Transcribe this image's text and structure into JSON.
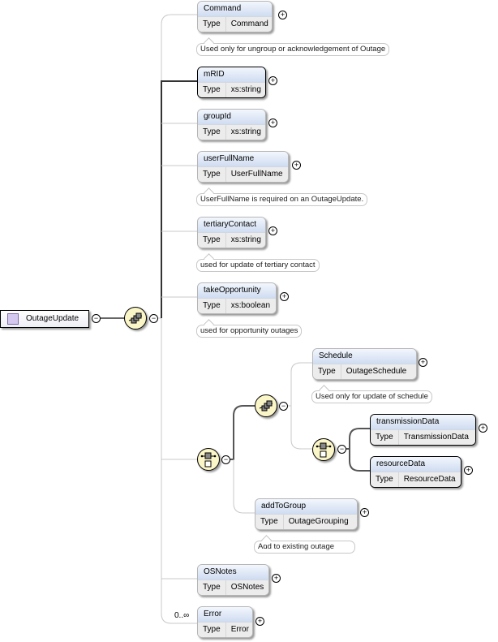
{
  "root": {
    "name": "OutageUpdate",
    "icon": "complex-type-icon"
  },
  "compositors": {
    "main_sequence": {
      "kind": "sequence",
      "icon": "sequence-icon"
    },
    "choice": {
      "kind": "choice",
      "icon": "choice-icon"
    },
    "inner_sequence": {
      "kind": "sequence",
      "icon": "sequence-icon"
    },
    "inner_choice": {
      "kind": "choice",
      "icon": "choice-icon"
    }
  },
  "type_label": "Type",
  "elements": {
    "command": {
      "name": "Command",
      "type": "Command",
      "doc": "Used only for ungroup or acknowledgement of Outage",
      "required": false
    },
    "mrid": {
      "name": "mRID",
      "type": "xs:string",
      "required": true
    },
    "groupid": {
      "name": "groupId",
      "type": "xs:string",
      "required": false
    },
    "userfullname": {
      "name": "userFullName",
      "type": "UserFullName",
      "doc": "UserFullName is required on an OutageUpdate.",
      "required": false
    },
    "tertiarycontact": {
      "name": "tertiaryContact",
      "type": "xs:string",
      "doc": "used for update of tertiary contact",
      "required": false
    },
    "takeopportunity": {
      "name": "takeOpportunity",
      "type": "xs:boolean",
      "doc": "used for opportunity outages",
      "required": false
    },
    "schedule": {
      "name": "Schedule",
      "type": "OutageSchedule",
      "doc": "Used only for update of schedule",
      "required": false
    },
    "transmissiondata": {
      "name": "transmissionData",
      "type": "TransmissionData",
      "required": true
    },
    "resourcedata": {
      "name": "resourceData",
      "type": "ResourceData",
      "required": true
    },
    "addtogroup": {
      "name": "addToGroup",
      "type": "OutageGrouping",
      "doc": "Add to existing outage",
      "required": false
    },
    "osnotes": {
      "name": "OSNotes",
      "type": "OSNotes",
      "required": false
    },
    "error": {
      "name": "Error",
      "type": "Error",
      "cardinality": "0..∞",
      "required": false
    }
  },
  "expand_symbol": "+",
  "collapse_symbol": "−"
}
